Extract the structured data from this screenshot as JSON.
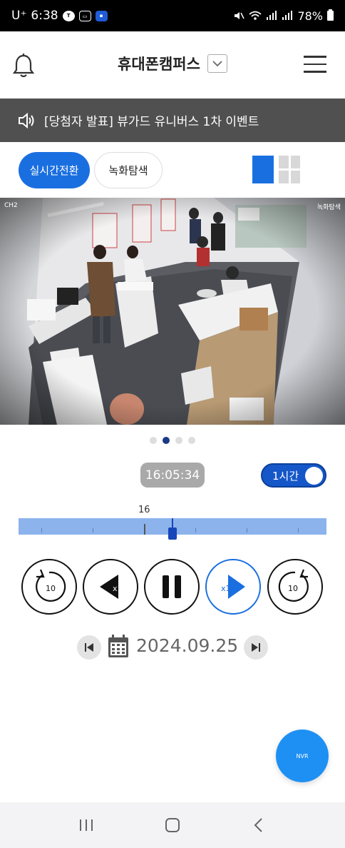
{
  "status_bar": {
    "carrier": "U⁺",
    "time": "6:38",
    "app_icons": [
      "kakaotalk-icon",
      "cctv-icon",
      "app-badge-icon"
    ],
    "battery": "78%"
  },
  "header": {
    "title": "휴대폰캠퍼스",
    "icons": {
      "left": "bell-icon",
      "dropdown": "chevron-down-icon",
      "right": "hamburger-menu-icon"
    }
  },
  "notice": {
    "icon": "speaker-icon",
    "text": "[당첨자 발표] 뷰가드 유니버스 1차 이벤트"
  },
  "mode": {
    "live_label": "실시간전환",
    "record_label": "녹화탐색",
    "active": "live",
    "accent": "#1a6fe0"
  },
  "camera": {
    "channel_label": "CH2",
    "overlay_label": "녹화탐색"
  },
  "pager": {
    "count": 4,
    "active_index": 1
  },
  "playback": {
    "current_time": "16:05:34",
    "range_label": "1시간",
    "timeline_hour": "16",
    "timeline_position": 0.5,
    "rewind_label": "10",
    "slow_label": "x1",
    "fast_label": "x1",
    "forward_label": "10"
  },
  "date": {
    "value": "2024.09.25"
  },
  "fab": {
    "label": "NVR"
  }
}
